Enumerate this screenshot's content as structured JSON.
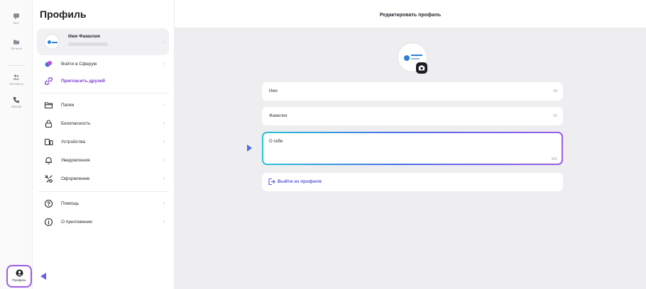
{
  "rail": {
    "items": [
      {
        "label": "Все",
        "icon": "chat-icon"
      },
      {
        "label": "Личные",
        "icon": "folder-icon"
      },
      {
        "label": "Контакты",
        "icon": "contacts-icon"
      },
      {
        "label": "Звонки",
        "icon": "phone-icon"
      }
    ],
    "profile": {
      "label": "Профиль",
      "icon": "user-icon"
    }
  },
  "settings": {
    "title": "Профиль",
    "profile_card": {
      "name": "Имя Фамилия"
    },
    "group1": [
      {
        "label": "Войти в Сферум",
        "icon": "sferum-icon"
      },
      {
        "label": "Пригласить друзей",
        "icon": "link-icon",
        "accent": true
      }
    ],
    "group2": [
      {
        "label": "Папки",
        "icon": "folder-outline-icon"
      },
      {
        "label": "Безопасность",
        "icon": "lock-icon"
      },
      {
        "label": "Устройства",
        "icon": "devices-icon"
      },
      {
        "label": "Уведомления",
        "icon": "bell-icon"
      },
      {
        "label": "Оформление",
        "icon": "palette-icon"
      }
    ],
    "group3": [
      {
        "label": "Помощь",
        "icon": "help-icon"
      },
      {
        "label": "О приложении",
        "icon": "info-icon"
      }
    ],
    "chevron": "›"
  },
  "main": {
    "title": "Редактировать профиль",
    "fields": {
      "first_name": {
        "label": "Имя",
        "count": "58"
      },
      "last_name": {
        "label": "Фамилия",
        "count": "63"
      },
      "about": {
        "label": "О себе",
        "count": "300"
      }
    },
    "logout_label": "Выйти из профиля"
  },
  "colors": {
    "accent_purple": "#9b5de5",
    "accent_blue": "#4b6fe6",
    "accent_teal": "#28c3d4",
    "link_color": "#5a5ad6",
    "arrow_color": "#6a5de8"
  }
}
